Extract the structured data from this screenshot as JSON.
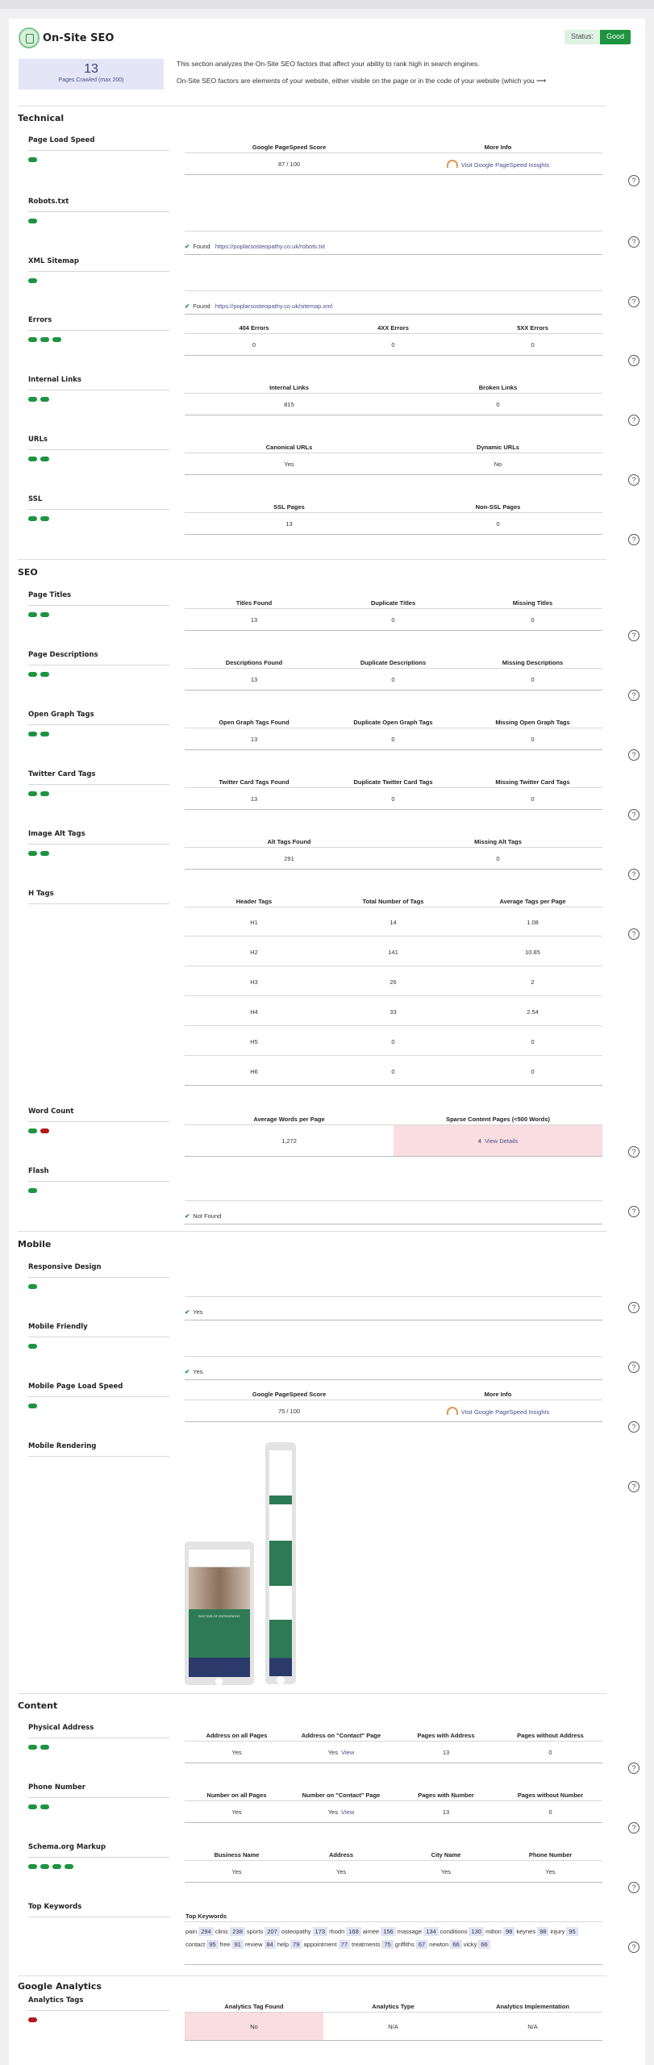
{
  "header": {
    "title": "On-Site SEO",
    "status_label": "Status:",
    "status_value": "Good",
    "pages_crawled": "13",
    "pages_crawled_label": "Pages Crawled (max 200)",
    "intro1": "This section analyzes the On-Site SEO factors that affect your ability to rank high in search engines.",
    "intro2": "On-Site SEO factors are elements of your website, either visible on the page or in the code of your website (which you ⟶"
  },
  "sections": {
    "technical": "Technical",
    "seo": "SEO",
    "mobile": "Mobile",
    "content": "Content",
    "analytics": "Google Analytics"
  },
  "tech": {
    "pls": {
      "label": "Page Load Speed",
      "h1": "Google PageSpeed Score",
      "h2": "More Info",
      "v1": "87 / 100",
      "v2": "Visit Google PageSpeed Insights"
    },
    "robots": {
      "label": "Robots.txt",
      "status": "Found",
      "url": "https://poplarsosteopathy.co.uk/robots.txt"
    },
    "xml": {
      "label": "XML Sitemap",
      "status": "Found",
      "url": "https://poplarsosteopathy.co.uk/sitemap.xml"
    },
    "errors": {
      "label": "Errors",
      "h1": "404 Errors",
      "h2": "4XX Errors",
      "h3": "5XX Errors",
      "v1": "0",
      "v2": "0",
      "v3": "0"
    },
    "links": {
      "label": "Internal Links",
      "h1": "Internal Links",
      "h2": "Broken Links",
      "v1": "815",
      "v2": "0"
    },
    "urls": {
      "label": "URLs",
      "h1": "Canonical URLs",
      "h2": "Dynamic URLs",
      "v1": "Yes",
      "v2": "No"
    },
    "ssl": {
      "label": "SSL",
      "h1": "SSL Pages",
      "h2": "Non-SSL Pages",
      "v1": "13",
      "v2": "0"
    }
  },
  "seo": {
    "titles": {
      "label": "Page Titles",
      "h1": "Titles Found",
      "h2": "Duplicate Titles",
      "h3": "Missing Titles",
      "v1": "13",
      "v2": "0",
      "v3": "0"
    },
    "desc": {
      "label": "Page Descriptions",
      "h1": "Descriptions Found",
      "h2": "Duplicate Descriptions",
      "h3": "Missing Descriptions",
      "v1": "13",
      "v2": "0",
      "v3": "0"
    },
    "og": {
      "label": "Open Graph Tags",
      "h1": "Open Graph Tags Found",
      "h2": "Duplicate Open Graph Tags",
      "h3": "Missing Open Graph Tags",
      "v1": "13",
      "v2": "0",
      "v3": "0"
    },
    "tw": {
      "label": "Twitter Card Tags",
      "h1": "Twitter Card Tags Found",
      "h2": "Duplicate Twitter Card Tags",
      "h3": "Missing Twitter Card Tags",
      "v1": "13",
      "v2": "0",
      "v3": "0"
    },
    "alt": {
      "label": "Image Alt Tags",
      "h1": "Alt Tags Found",
      "h2": "Missing Alt Tags",
      "v1": "291",
      "v2": "0"
    },
    "htags": {
      "label": "H Tags",
      "h1": "Header Tags",
      "h2": "Total Number of Tags",
      "h3": "Average Tags per Page",
      "rows": [
        [
          "H1",
          "14",
          "1.08"
        ],
        [
          "H2",
          "141",
          "10.85"
        ],
        [
          "H3",
          "26",
          "2"
        ],
        [
          "H4",
          "33",
          "2.54"
        ],
        [
          "H5",
          "0",
          "0"
        ],
        [
          "H6",
          "0",
          "0"
        ]
      ]
    },
    "wc": {
      "label": "Word Count",
      "h1": "Average Words per Page",
      "h2": "Sparse Content Pages (<500 Words)",
      "v1": "1,272",
      "v2": "4",
      "v3": "View Details"
    },
    "flash": {
      "label": "Flash",
      "status": "Not Found"
    }
  },
  "mobile": {
    "resp": {
      "label": "Responsive Design",
      "status": "Yes"
    },
    "friendly": {
      "label": "Mobile Friendly",
      "status": "Yes"
    },
    "pls": {
      "label": "Mobile Page Load Speed",
      "h1": "Google PageSpeed Score",
      "h2": "More Info",
      "v1": "75 / 100",
      "v2": "Visit Google PageSpeed Insights"
    },
    "render": {
      "label": "Mobile Rendering",
      "screen_heading": "DOCTOR OF OSTEOPATHY"
    }
  },
  "content": {
    "addr": {
      "label": "Physical Address",
      "h1": "Address on all Pages",
      "h2": "Address on \"Contact\" Page",
      "h3": "Pages with Address",
      "h4": "Pages without Address",
      "v1": "Yes",
      "v2": "Yes",
      "v2link": "View",
      "v3": "13",
      "v4": "0"
    },
    "phone": {
      "label": "Phone Number",
      "h1": "Number on all Pages",
      "h2": "Number on \"Contact\" Page",
      "h3": "Pages with Number",
      "h4": "Pages without Number",
      "v1": "Yes",
      "v2": "Yes",
      "v2link": "View",
      "v3": "13",
      "v4": "0"
    },
    "schema": {
      "label": "Schema.org Markup",
      "h1": "Business Name",
      "h2": "Address",
      "h3": "City Name",
      "h4": "Phone Number",
      "v1": "Yes",
      "v2": "Yes",
      "v3": "Yes",
      "v4": "Yes"
    },
    "kw": {
      "label": "Top Keywords",
      "heading": "Top Keywords",
      "items": [
        [
          "pain",
          "294"
        ],
        [
          "clinic",
          "238"
        ],
        [
          "sports",
          "207"
        ],
        [
          "osteopathy",
          "173"
        ],
        [
          "rhodri",
          "168"
        ],
        [
          "aimee",
          "156"
        ],
        [
          "massage",
          "134"
        ],
        [
          "conditions",
          "130"
        ],
        [
          "milton",
          "98"
        ],
        [
          "keynes",
          "98"
        ],
        [
          "injury",
          "95"
        ],
        [
          "contact",
          "95"
        ],
        [
          "free",
          "91"
        ],
        [
          "review",
          "84"
        ],
        [
          "help",
          "79"
        ],
        [
          "appointment",
          "77"
        ],
        [
          "treatments",
          "75"
        ],
        [
          "griffiths",
          "67"
        ],
        [
          "newton",
          "66"
        ],
        [
          "vicky",
          "66"
        ]
      ]
    }
  },
  "analytics": {
    "label": "Analytics Tags",
    "h1": "Analytics Tag Found",
    "h2": "Analytics Type",
    "h3": "Analytics Implementation",
    "v1": "No",
    "v2": "N/A",
    "v3": "N/A"
  },
  "help_glyph": "?",
  "check_glyph": "✔",
  "colors": {
    "good": "#1e9440",
    "bad": "#b11c1c",
    "accent": "#4a4d88",
    "pink": "#f9dde0"
  }
}
